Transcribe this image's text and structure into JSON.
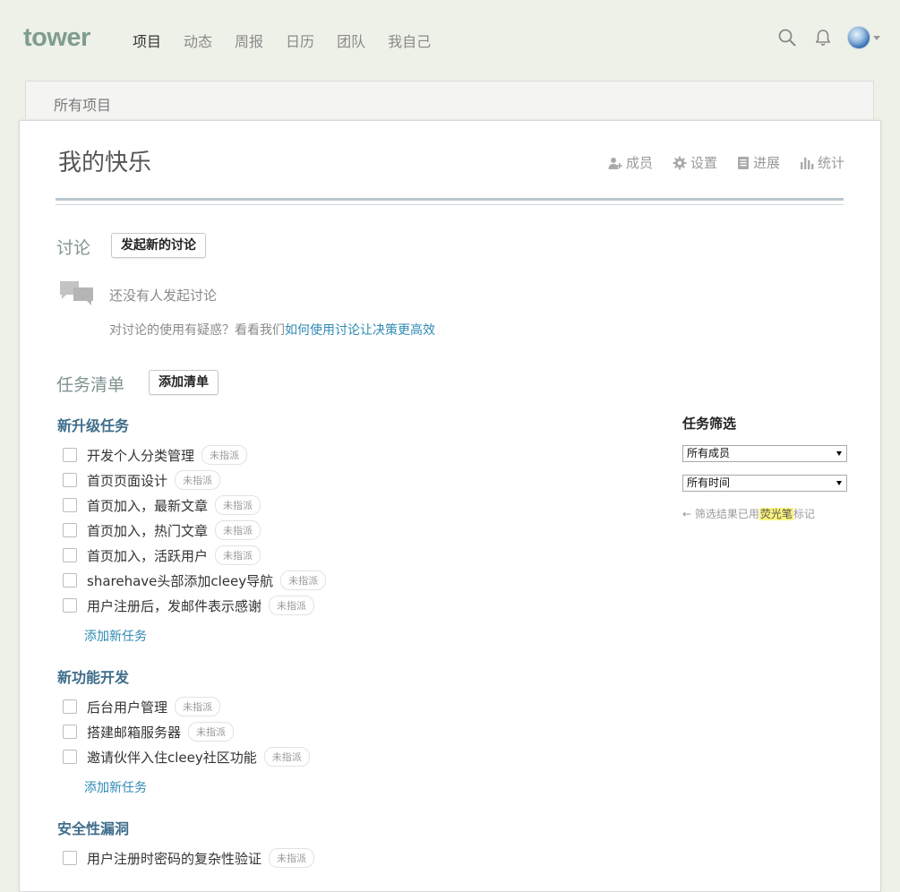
{
  "nav": {
    "logo": "tower",
    "items": [
      "项目",
      "动态",
      "周报",
      "日历",
      "团队",
      "我自己"
    ],
    "active_index": 0,
    "icons": [
      "search-icon",
      "bell-icon"
    ]
  },
  "breadcrumb": {
    "label": "所有项目"
  },
  "project": {
    "title": "我的快乐",
    "actions": [
      {
        "label": "成员",
        "icon": "add-member-icon"
      },
      {
        "label": "设置",
        "icon": "gear-icon"
      },
      {
        "label": "进展",
        "icon": "document-icon"
      },
      {
        "label": "统计",
        "icon": "bar-chart-icon"
      }
    ]
  },
  "discussion": {
    "title": "讨论",
    "new_button": "发起新的讨论",
    "empty_text": "还没有人发起讨论",
    "help_prefix": "对讨论的使用有疑惑？看看我们",
    "help_link": "如何使用讨论让决策更高效"
  },
  "todos": {
    "title": "任务清单",
    "add_list_button": "添加清单",
    "add_task_label": "添加新任务",
    "lists": [
      {
        "name": "新升级任务",
        "tasks": [
          {
            "name": "开发个人分类管理",
            "assignee": "未指派"
          },
          {
            "name": "首页页面设计",
            "assignee": "未指派"
          },
          {
            "name": "首页加入，最新文章",
            "assignee": "未指派"
          },
          {
            "name": "首页加入，热门文章",
            "assignee": "未指派"
          },
          {
            "name": "首页加入，活跃用户",
            "assignee": "未指派"
          },
          {
            "name": "sharehave头部添加cleey导航",
            "assignee": "未指派"
          },
          {
            "name": "用户注册后，发邮件表示感谢",
            "assignee": "未指派"
          }
        ]
      },
      {
        "name": "新功能开发",
        "tasks": [
          {
            "name": "后台用户管理",
            "assignee": "未指派"
          },
          {
            "name": "搭建邮箱服务器",
            "assignee": "未指派"
          },
          {
            "name": "邀请伙伴入住cleey社区功能",
            "assignee": "未指派"
          }
        ]
      },
      {
        "name": "安全性漏洞",
        "tasks": [
          {
            "name": "用户注册时密码的复杂性验证",
            "assignee": "未指派"
          }
        ]
      }
    ]
  },
  "filter": {
    "title": "任务筛选",
    "member_select": "所有成员",
    "time_select": "所有时间",
    "hint_prefix": "← 筛选结果已用",
    "hint_highlight": "荧光笔",
    "hint_suffix": "标记"
  },
  "colors": {
    "background": "#eef1e8",
    "logo": "#7f9c8f",
    "section_title": "#7e9390",
    "list_title": "#3f6e8c",
    "link": "#2f8ab5",
    "highlight": "#fcf37c"
  }
}
